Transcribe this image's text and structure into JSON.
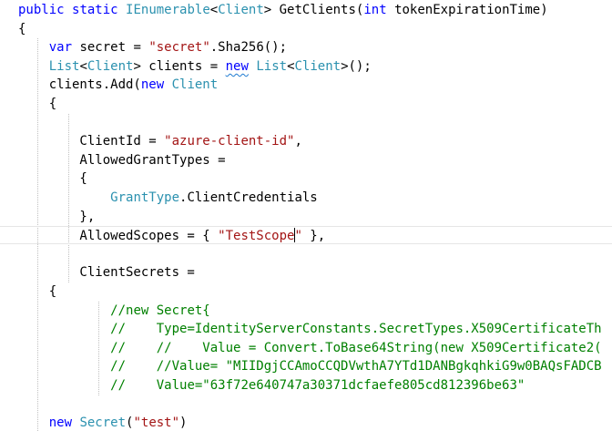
{
  "editor": {
    "lines": [
      {
        "segments": [
          {
            "t": "public",
            "c": "kw"
          },
          {
            "t": " ",
            "c": "tx"
          },
          {
            "t": "static",
            "c": "kw"
          },
          {
            "t": " ",
            "c": "tx"
          },
          {
            "t": "IEnumerable",
            "c": "ty"
          },
          {
            "t": "<",
            "c": "tx"
          },
          {
            "t": "Client",
            "c": "ty"
          },
          {
            "t": "> GetClients(",
            "c": "tx"
          },
          {
            "t": "int",
            "c": "kw"
          },
          {
            "t": " tokenExpirationTime)",
            "c": "tx"
          }
        ]
      },
      {
        "segments": [
          {
            "t": "{",
            "c": "tx"
          }
        ]
      },
      {
        "segments": [
          {
            "t": "    ",
            "c": "tx"
          },
          {
            "t": "var",
            "c": "kw"
          },
          {
            "t": " secret = ",
            "c": "tx"
          },
          {
            "t": "\"secret\"",
            "c": "st"
          },
          {
            "t": ".Sha256();",
            "c": "tx"
          }
        ]
      },
      {
        "segments": [
          {
            "t": "    ",
            "c": "tx"
          },
          {
            "t": "List",
            "c": "ty"
          },
          {
            "t": "<",
            "c": "tx"
          },
          {
            "t": "Client",
            "c": "ty"
          },
          {
            "t": "> clients = ",
            "c": "tx"
          },
          {
            "t": "new",
            "c": "kw",
            "u": true
          },
          {
            "t": " ",
            "c": "tx"
          },
          {
            "t": "List",
            "c": "ty"
          },
          {
            "t": "<",
            "c": "tx"
          },
          {
            "t": "Client",
            "c": "ty"
          },
          {
            "t": ">();",
            "c": "tx"
          }
        ]
      },
      {
        "segments": [
          {
            "t": "    clients.Add(",
            "c": "tx"
          },
          {
            "t": "new",
            "c": "kw"
          },
          {
            "t": " ",
            "c": "tx"
          },
          {
            "t": "Client",
            "c": "ty"
          }
        ]
      },
      {
        "segments": [
          {
            "t": "    {",
            "c": "tx"
          }
        ]
      },
      {
        "segments": [
          {
            "t": "",
            "c": "tx"
          }
        ]
      },
      {
        "segments": [
          {
            "t": "        ClientId = ",
            "c": "tx"
          },
          {
            "t": "\"azure-client-id\"",
            "c": "st"
          },
          {
            "t": ",",
            "c": "tx"
          }
        ]
      },
      {
        "segments": [
          {
            "t": "        AllowedGrantTypes =",
            "c": "tx"
          }
        ]
      },
      {
        "segments": [
          {
            "t": "        {",
            "c": "tx"
          }
        ]
      },
      {
        "segments": [
          {
            "t": "            ",
            "c": "tx"
          },
          {
            "t": "GrantType",
            "c": "ty"
          },
          {
            "t": ".ClientCredentials",
            "c": "tx"
          }
        ]
      },
      {
        "segments": [
          {
            "t": "        },",
            "c": "tx"
          }
        ]
      },
      {
        "current": true,
        "segments": [
          {
            "t": "        AllowedScopes = { ",
            "c": "tx"
          },
          {
            "t": "\"TestScope\"",
            "c": "st"
          },
          {
            "t": " },",
            "c": "tx"
          }
        ]
      },
      {
        "segments": [
          {
            "t": "",
            "c": "tx"
          }
        ]
      },
      {
        "segments": [
          {
            "t": "        ClientSecrets =",
            "c": "tx"
          }
        ]
      },
      {
        "segments": [
          {
            "t": "    {",
            "c": "tx"
          }
        ]
      },
      {
        "segments": [
          {
            "t": "            ",
            "c": "tx"
          },
          {
            "t": "//new Secret{",
            "c": "cm"
          }
        ]
      },
      {
        "segments": [
          {
            "t": "            ",
            "c": "tx"
          },
          {
            "t": "//    Type=IdentityServerConstants.SecretTypes.X509CertificateTh",
            "c": "cm"
          }
        ]
      },
      {
        "segments": [
          {
            "t": "            ",
            "c": "tx"
          },
          {
            "t": "//    //    Value = Convert.ToBase64String(new X509Certificate2(",
            "c": "cm"
          }
        ]
      },
      {
        "segments": [
          {
            "t": "            ",
            "c": "tx"
          },
          {
            "t": "//    //Value= \"MIIDgjCCAmoCCQDVwthA7YTd1DANBgkqhkiG9w0BAQsFADCB",
            "c": "cm"
          }
        ]
      },
      {
        "segments": [
          {
            "t": "            ",
            "c": "tx"
          },
          {
            "t": "//    Value=\"63f72e640747a30371dcfaefe805cd812396be63\"",
            "c": "cm"
          }
        ]
      },
      {
        "segments": [
          {
            "t": "",
            "c": "tx"
          }
        ]
      },
      {
        "segments": [
          {
            "t": "    ",
            "c": "tx"
          },
          {
            "t": "new",
            "c": "kw"
          },
          {
            "t": " ",
            "c": "tx"
          },
          {
            "t": "Secret",
            "c": "ty"
          },
          {
            "t": "(",
            "c": "tx"
          },
          {
            "t": "\"test\"",
            "c": "st"
          },
          {
            "t": ")",
            "c": "tx"
          }
        ]
      }
    ]
  }
}
